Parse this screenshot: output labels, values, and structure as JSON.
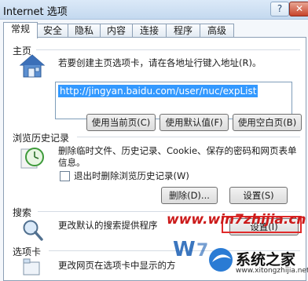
{
  "window": {
    "title": "Internet 选项",
    "help_label": "?",
    "close_label": "✕"
  },
  "tabs": [
    {
      "label": "常规",
      "active": true
    },
    {
      "label": "安全"
    },
    {
      "label": "隐私"
    },
    {
      "label": "内容"
    },
    {
      "label": "连接"
    },
    {
      "label": "程序"
    },
    {
      "label": "高级"
    }
  ],
  "home": {
    "section_label": "主页",
    "description": "若要创建主页选项卡，请在各地址行键入地址(R)。",
    "url": "http://jingyan.baidu.com/user/nuc/expList",
    "buttons": {
      "use_current": "使用当前页(C)",
      "use_default": "使用默认值(F)",
      "use_blank": "使用空白页(B)"
    },
    "icon": "house-icon"
  },
  "history": {
    "section_label": "浏览历史记录",
    "description_line1": "删除临时文件、历史记录、Cookie、保存的密码和网页表单",
    "description_line2": "信息。",
    "checkbox_label": "退出时删除浏览历史记录(W)",
    "checkbox_checked": false,
    "buttons": {
      "delete": "删除(D)...",
      "settings": "设置(S)"
    },
    "icon": "history-clock-icon"
  },
  "search": {
    "section_label": "搜索",
    "description": "更改默认的搜索提供程序",
    "settings_button": "设置(I)",
    "icon": "magnifier-icon"
  },
  "tabs_section": {
    "section_label": "选项卡",
    "description": "更改网页在选项卡中显示的方"
  },
  "watermark": {
    "site": "www.win7zhijia.cn",
    "logo_text": "系统之家",
    "logo_sub": "www.xitongzhijia.net",
    "accent": "#e02a2a"
  },
  "colors": {
    "selection": "#3399ff",
    "panel_border": "#8c9fb5"
  }
}
